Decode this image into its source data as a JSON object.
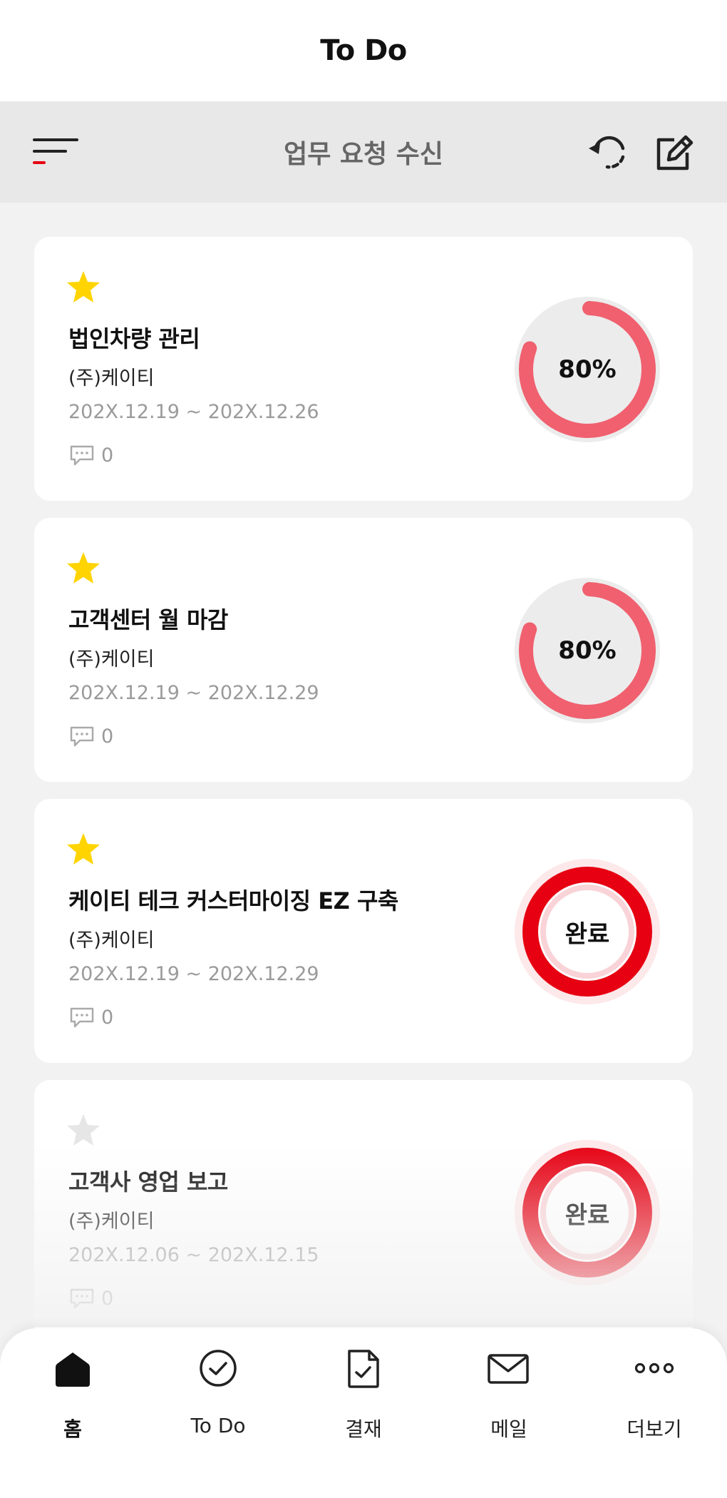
{
  "header": {
    "title": "To Do"
  },
  "toolbar": {
    "title": "업무 요청 수신",
    "menu_icon": "menu-icon",
    "refresh_icon": "refresh-icon",
    "edit_icon": "edit-icon"
  },
  "colors": {
    "accent": "#e60012",
    "progress": "#f0606f",
    "star_on": "#ffd400",
    "star_off": "#e6e6e6"
  },
  "tasks": [
    {
      "starred": true,
      "title": "법인차량 관리",
      "company": "(주)케이티",
      "period": "202X.12.19 ~ 202X.12.26",
      "comments": "0",
      "status": "progress",
      "progress": 0.8,
      "progress_label": "80%"
    },
    {
      "starred": true,
      "title": "고객센터 월 마감",
      "company": "(주)케이티",
      "period": "202X.12.19 ~ 202X.12.29",
      "comments": "0",
      "status": "progress",
      "progress": 0.8,
      "progress_label": "80%"
    },
    {
      "starred": true,
      "title": "케이티 테크 커스터마이징 EZ 구축",
      "company": "(주)케이티",
      "period": "202X.12.19 ~ 202X.12.29",
      "comments": "0",
      "status": "done",
      "progress": 1.0,
      "progress_label": "완료"
    },
    {
      "starred": false,
      "title": "고객사 영업 보고",
      "company": "(주)케이티",
      "period": "202X.12.06 ~ 202X.12.15",
      "comments": "0",
      "status": "done",
      "progress": 1.0,
      "progress_label": "완료"
    }
  ],
  "nav": [
    {
      "label": "홈",
      "icon": "home-icon",
      "active": true
    },
    {
      "label": "To Do",
      "icon": "check-circle-icon",
      "active": false
    },
    {
      "label": "결재",
      "icon": "document-check-icon",
      "active": false
    },
    {
      "label": "메일",
      "icon": "mail-icon",
      "active": false
    },
    {
      "label": "더보기",
      "icon": "more-icon",
      "active": false
    }
  ]
}
